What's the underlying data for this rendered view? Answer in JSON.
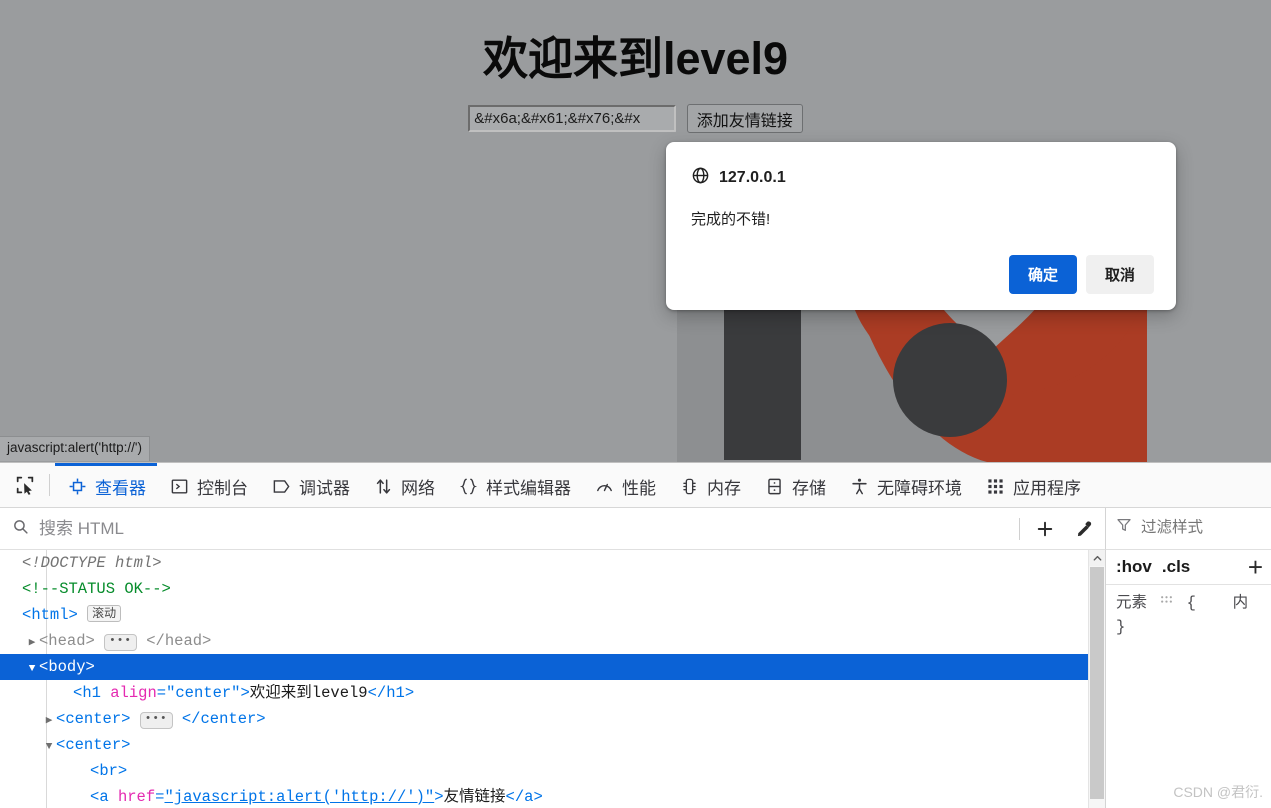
{
  "page": {
    "title": "欢迎来到level9",
    "link_input_value": "&#x6a;&#x61;&#x76;&#x",
    "add_link_button": "添加友情链接",
    "background_color": "#9a9c9e"
  },
  "dialog": {
    "origin": "127.0.0.1",
    "message": "完成的不错!",
    "confirm_label": "确定",
    "cancel_label": "取消",
    "confirm_color": "#0b62d6",
    "cancel_color": "#f0f0f0"
  },
  "status_bar": {
    "link_target": "javascript:alert('http://')"
  },
  "devtools": {
    "tabs": [
      {
        "label": "查看器",
        "icon": "inspector-icon",
        "active": true
      },
      {
        "label": "控制台",
        "icon": "console-icon",
        "active": false
      },
      {
        "label": "调试器",
        "icon": "debugger-icon",
        "active": false
      },
      {
        "label": "网络",
        "icon": "network-icon",
        "active": false
      },
      {
        "label": "样式编辑器",
        "icon": "style-editor-icon",
        "active": false
      },
      {
        "label": "性能",
        "icon": "performance-icon",
        "active": false
      },
      {
        "label": "内存",
        "icon": "memory-icon",
        "active": false
      },
      {
        "label": "存储",
        "icon": "storage-icon",
        "active": false
      },
      {
        "label": "无障碍环境",
        "icon": "accessibility-icon",
        "active": false
      },
      {
        "label": "应用程序",
        "icon": "application-icon",
        "active": false
      }
    ],
    "picker_icon": "element-picker-icon",
    "search": {
      "placeholder": "搜索 HTML",
      "value": "",
      "icon": "search-icon"
    },
    "add_node_icon": "plus-icon",
    "eyedropper_icon": "eyedropper-icon",
    "accent_color": "#0b62d6"
  },
  "markup": {
    "rows": [
      {
        "id": "doctype",
        "indent": 1,
        "twisty": "",
        "selected": false,
        "parts": [
          {
            "cls": "doctype",
            "text": "<!DOCTYPE html>"
          }
        ]
      },
      {
        "id": "status-comment",
        "indent": 1,
        "twisty": "",
        "selected": false,
        "parts": [
          {
            "cls": "comment",
            "text": "<!--STATUS OK-->"
          }
        ]
      },
      {
        "id": "html-open",
        "indent": 1,
        "twisty": "",
        "selected": false,
        "parts": [
          {
            "cls": "punct",
            "text": "<"
          },
          {
            "cls": "tag",
            "text": "html"
          },
          {
            "cls": "punct",
            "text": ">"
          },
          {
            "cls": "badge",
            "text": "滚动"
          }
        ]
      },
      {
        "id": "head",
        "indent": 2,
        "twisty": "collapsed",
        "selected": false,
        "parts": [
          {
            "cls": "tag-closed",
            "text": "<head>"
          },
          {
            "cls": "ellipsis",
            "text": "•••"
          },
          {
            "cls": "tag-closed",
            "text": "</head>"
          }
        ]
      },
      {
        "id": "body",
        "indent": 2,
        "twisty": "expanded",
        "selected": true,
        "parts": [
          {
            "cls": "punct",
            "text": "<"
          },
          {
            "cls": "tag",
            "text": "body"
          },
          {
            "cls": "punct",
            "text": ">"
          }
        ]
      },
      {
        "id": "h1",
        "indent": 4,
        "twisty": "",
        "selected": false,
        "parts": [
          {
            "cls": "punct",
            "text": "<"
          },
          {
            "cls": "tag",
            "text": "h1"
          },
          {
            "cls": "space",
            "text": " "
          },
          {
            "cls": "attr-name",
            "text": "align"
          },
          {
            "cls": "punct",
            "text": "="
          },
          {
            "cls": "attr-val",
            "text": "\"center\""
          },
          {
            "cls": "punct",
            "text": ">"
          },
          {
            "cls": "textnode",
            "text": "欢迎来到level9"
          },
          {
            "cls": "punct",
            "text": "</"
          },
          {
            "cls": "tag",
            "text": "h1"
          },
          {
            "cls": "punct",
            "text": ">"
          }
        ]
      },
      {
        "id": "center-collapsed",
        "indent": 3,
        "twisty": "collapsed",
        "selected": false,
        "parts": [
          {
            "cls": "punct",
            "text": "<"
          },
          {
            "cls": "tag",
            "text": "center"
          },
          {
            "cls": "punct",
            "text": ">"
          },
          {
            "cls": "ellipsis",
            "text": "•••"
          },
          {
            "cls": "punct",
            "text": "</"
          },
          {
            "cls": "tag",
            "text": "center"
          },
          {
            "cls": "punct",
            "text": ">"
          }
        ]
      },
      {
        "id": "center-expanded",
        "indent": 3,
        "twisty": "expanded",
        "selected": false,
        "parts": [
          {
            "cls": "punct",
            "text": "<"
          },
          {
            "cls": "tag",
            "text": "center"
          },
          {
            "cls": "punct",
            "text": ">"
          }
        ]
      },
      {
        "id": "br",
        "indent": 5,
        "twisty": "",
        "selected": false,
        "parts": [
          {
            "cls": "punct",
            "text": "<"
          },
          {
            "cls": "tag",
            "text": "br"
          },
          {
            "cls": "punct",
            "text": ">"
          }
        ]
      },
      {
        "id": "anchor",
        "indent": 5,
        "twisty": "",
        "selected": false,
        "parts": [
          {
            "cls": "punct",
            "text": "<"
          },
          {
            "cls": "tag",
            "text": "a"
          },
          {
            "cls": "space",
            "text": " "
          },
          {
            "cls": "attr-name",
            "text": "href"
          },
          {
            "cls": "punct",
            "text": "="
          },
          {
            "cls": "attr-link",
            "text": "\"javascript:alert('http://')\""
          },
          {
            "cls": "punct",
            "text": ">"
          },
          {
            "cls": "textnode",
            "text": "友情链接"
          },
          {
            "cls": "punct",
            "text": "</"
          },
          {
            "cls": "tag",
            "text": "a"
          },
          {
            "cls": "punct",
            "text": ">"
          }
        ]
      }
    ]
  },
  "rules_panel": {
    "filter_placeholder": "过滤样式",
    "filter_icon": "filter-icon",
    "pseudo_hover": ":hov",
    "pseudo_cls": ".cls",
    "add_rule": "+",
    "element_label": "元素",
    "brace_open": "{",
    "inline_label": "内",
    "brace_close": "}"
  },
  "watermark": "CSDN @君衍."
}
